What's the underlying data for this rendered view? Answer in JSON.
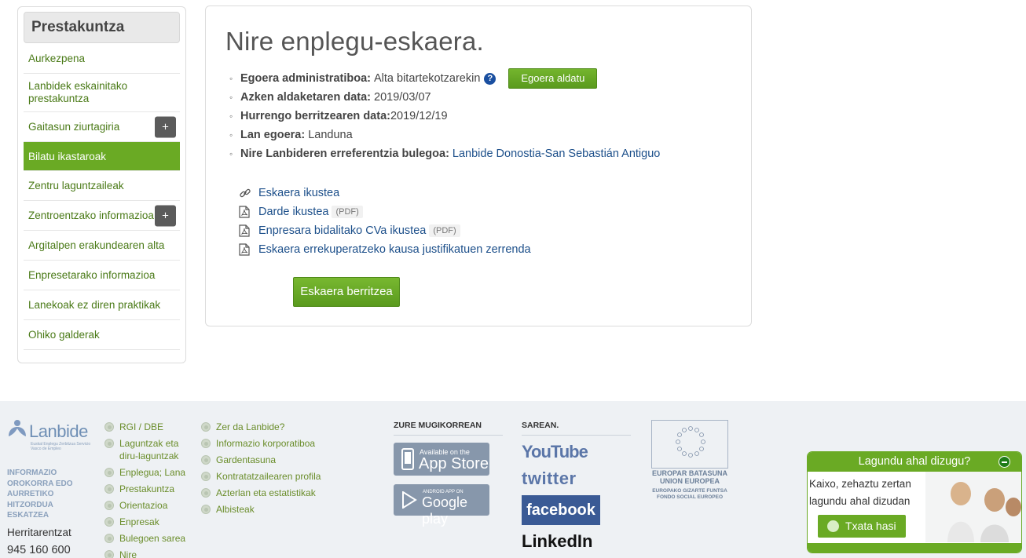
{
  "sidebar": {
    "title": "Prestakuntza",
    "items": [
      {
        "label": "Aurkezpena"
      },
      {
        "label": "Lanbidek eskainitako prestakuntza"
      },
      {
        "label": "Gaitasun ziurtagiria",
        "plus": "+"
      },
      {
        "label": "Bilatu ikastaroak",
        "active": true
      },
      {
        "label": "Zentru laguntzaileak"
      },
      {
        "label": "Zentroentzako informazioa",
        "plus": "+"
      },
      {
        "label": "Argitalpen erakundearen alta"
      },
      {
        "label": "Enpresetarako informazioa"
      },
      {
        "label": "Lanekoak ez diren praktikak"
      },
      {
        "label": "Ohiko galderak"
      }
    ]
  },
  "main": {
    "title": "Nire enplegu-eskaera.",
    "info": {
      "status_label": "Egoera administratiboa:",
      "status_value": "Alta bitartekotzarekin",
      "help_icon": "?",
      "change_button": "Egoera aldatu",
      "last_change_label": "Azken aldaketaren data:",
      "last_change_value": "2019/03/07",
      "next_renewal_label": "Hurrengo berritzearen data:",
      "next_renewal_value": "2019/12/19",
      "work_status_label": "Lan egoera:",
      "work_status_value": "Landuna",
      "office_label": "Nire Lanbideren erreferentzia bulegoa:",
      "office_value": "Lanbide Donostia-San Sebastián Antiguo"
    },
    "links": [
      {
        "label": "Eskaera ikustea",
        "icon": "link-icon"
      },
      {
        "label": "Darde ikustea",
        "tag": "(PDF)",
        "icon": "pdf-icon"
      },
      {
        "label": "Enpresara bidalitako CVa ikustea",
        "tag": "(PDF)",
        "icon": "pdf-icon"
      },
      {
        "label": "Eskaera errekuperatzeko kausa justifikatuen zerrenda",
        "icon": "pdf-icon"
      }
    ],
    "renew_button": "Eskaera berritzea"
  },
  "footer": {
    "logo_text": "Lanbide",
    "logo_sub": "Euskal Enplegu Zerbitzua Servicio Vasco de Empleo",
    "lead_lines": [
      "INFORMAZIO",
      "OROKORRA EDO",
      "AURRETIKO",
      "HITZORDUA",
      "ESKATZEA"
    ],
    "citizens_label": "Herritarentzat",
    "phone": "945 160 600",
    "col1": [
      "RGI / DBE",
      "Laguntzak eta diru-laguntzak",
      "Enplegua; Lana",
      "Prestakuntza",
      "Orientazioa",
      "Enpresak",
      "Bulegoen sarea",
      "Nire"
    ],
    "col2": [
      "Zer da Lanbide?",
      "Informazio korporatiboa",
      "Gardentasuna",
      "Kontratatzailearen profila",
      "Azterlan eta estatistikak",
      "Albisteak"
    ],
    "mobile_heading": "ZURE MUGIKORREAN",
    "app_store_small": "Available on the",
    "app_store_big": "App Store",
    "google_small": "ANDROID APP ON",
    "google_big": "Google play",
    "social_heading": "SAREAN.",
    "social": [
      "YouTube",
      "twitter",
      "facebook",
      "LinkedIn"
    ],
    "eu_line1": "EUROPAR BATASUNA",
    "eu_line2": "UNION EUROPEA",
    "eu_line3": "EUROPAKO GIZARTE FUNTSA",
    "eu_line4": "FONDO SOCIAL EUROPEO"
  },
  "chat": {
    "title": "Lagundu ahal dizugu?",
    "message": "Kaixo, zehaztu zertan lagundu ahal dizudan",
    "button": "Txata hasi"
  },
  "colors": {
    "accent_green": "#6aaa24",
    "link_blue": "#1c4f8a",
    "footer_bg": "#eef1f4"
  }
}
